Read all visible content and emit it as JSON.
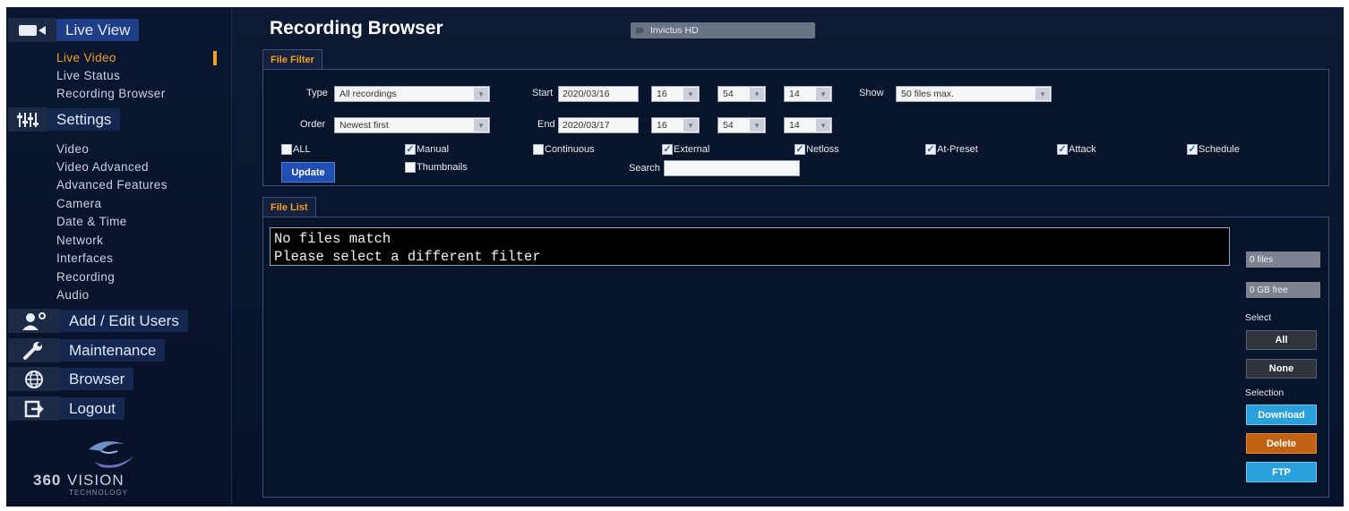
{
  "sidebar": {
    "sections": {
      "live_view": "Live View",
      "settings": "Settings",
      "add_edit_users": "Add / Edit Users",
      "maintenance": "Maintenance",
      "browser": "Browser",
      "logout": "Logout"
    },
    "live_items": [
      "Live Video",
      "Live Status",
      "Recording Browser"
    ],
    "settings_items": [
      "Video",
      "Video Advanced",
      "Advanced Features",
      "Camera",
      "Date & Time",
      "Network",
      "Interfaces",
      "Recording",
      "Audio"
    ],
    "active_item": "Live Video",
    "logo": {
      "brand": "360VISION",
      "sub": "TECHNOLOGY"
    }
  },
  "header": {
    "title": "Recording Browser",
    "device": "Invictus HD"
  },
  "filter": {
    "tab": "File Filter",
    "type_label": "Type",
    "type_value": "All recordings",
    "order_label": "Order",
    "order_value": "Newest first",
    "start_label": "Start",
    "start_date": "2020/03/16",
    "start_h": "16",
    "start_m": "54",
    "start_s": "14",
    "end_label": "End",
    "end_date": "2020/03/17",
    "end_h": "16",
    "end_m": "54",
    "end_s": "14",
    "show_label": "Show",
    "show_value": "50 files max.",
    "checkboxes": [
      {
        "label": "ALL",
        "checked": false
      },
      {
        "label": "Manual",
        "checked": true
      },
      {
        "label": "Continuous",
        "checked": false
      },
      {
        "label": "External",
        "checked": true
      },
      {
        "label": "Netloss",
        "checked": true
      },
      {
        "label": "At-Preset",
        "checked": true
      },
      {
        "label": "Attack",
        "checked": true
      },
      {
        "label": "Schedule",
        "checked": true
      }
    ],
    "thumbnails_label": "Thumbnails",
    "thumbnails_checked": false,
    "search_label": "Search",
    "search_value": "",
    "update_label": "Update"
  },
  "file_list": {
    "tab": "File List",
    "message_line1": "No files match",
    "message_line2": "Please select a different filter",
    "files_count": "0 files",
    "free_space": "0 GB free",
    "select_label": "Select",
    "all_label": "All",
    "none_label": "None",
    "selection_label": "Selection",
    "download_label": "Download",
    "delete_label": "Delete",
    "ftp_label": "FTP"
  },
  "colors": {
    "accent": "#f0a020",
    "download": "#2aa0dc",
    "delete": "#c26212"
  }
}
